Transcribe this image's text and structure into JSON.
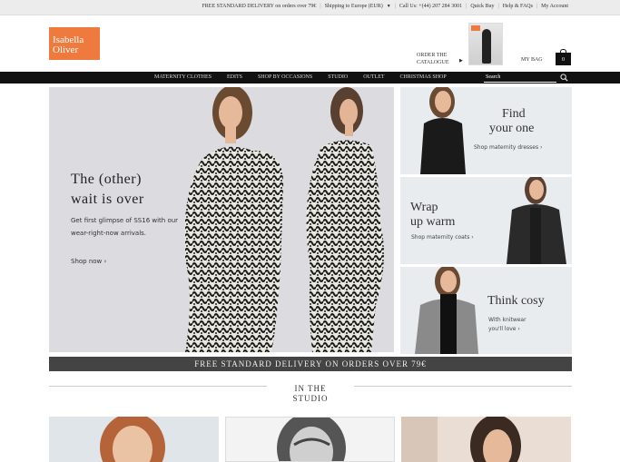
{
  "topbar": {
    "delivery": "FREE STANDARD DELIVERY on orders over 79€",
    "shipping": "Shipping to Europe (EUR)",
    "call": "Call Us: +(44) 207 284 3001",
    "quick_buy": "Quick Buy",
    "help": "Help & FAQs",
    "account": "My Account"
  },
  "brand": {
    "line1": "Isabella",
    "line2": "Oliver",
    "color": "#ef7a3d"
  },
  "catalogue": {
    "line1": "ORDER THE",
    "line2": "CATALOGUE"
  },
  "bag": {
    "label": "MY BAG",
    "count": "0"
  },
  "nav": {
    "items": [
      "MATERNITY CLOTHES",
      "EDITS",
      "SHOP BY OCCASIONS",
      "STUDIO",
      "OUTLET",
      "CHRISTMAS SHOP"
    ],
    "search_placeholder": "Search"
  },
  "hero": {
    "title_line1": "The (other)",
    "title_line2": "wait is over",
    "body": "Get first glimpse of SS16 with our wear-right-now arrivals.",
    "cta": "Shop now ›"
  },
  "tiles": [
    {
      "title_line1": "Find",
      "title_line2": "your one",
      "sub": "Shop maternity dresses ›"
    },
    {
      "title_line1": "Wrap",
      "title_line2": "up warm",
      "sub": "Shop maternity coats ›"
    },
    {
      "title_line1": "Think cosy",
      "sub_line1": "With knitwear",
      "sub_line2": "you'll love ›"
    }
  ],
  "band": {
    "text": "FREE STANDARD DELIVERY ON ORDERS OVER 79€"
  },
  "studio": {
    "line1": "IN THE",
    "line2": "STUDIO"
  }
}
